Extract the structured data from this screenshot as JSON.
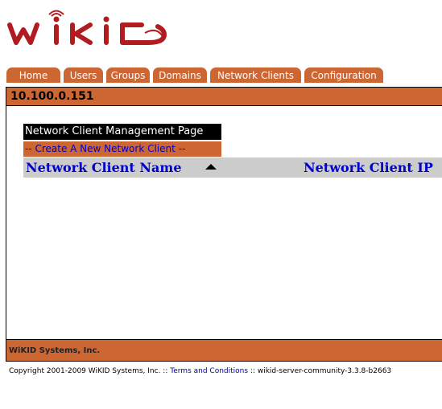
{
  "brand": {
    "logo_text": "WiKID",
    "accent_color": "#cc6633",
    "logo_color": "#b01c20"
  },
  "nav": {
    "tabs": [
      {
        "label": "Home"
      },
      {
        "label": "Users"
      },
      {
        "label": "Groups"
      },
      {
        "label": "Domains"
      },
      {
        "label": "Network Clients"
      },
      {
        "label": "Configuration"
      }
    ]
  },
  "server": {
    "ip": "10.100.0.151"
  },
  "main": {
    "page_title": "Network Client Management Page",
    "create_link": "-- Create A New Network Client --",
    "columns": [
      {
        "label": "Network Client Name",
        "sort_icon": "sort-ascending-icon"
      },
      {
        "label": "Network Client IP"
      }
    ],
    "rows": []
  },
  "footer": {
    "company": "WiKID Systems, Inc.",
    "copyright": "Copyright 2001-2009 WiKID Systems, Inc. ::",
    "terms_link": "Terms and Conditions",
    "version": ":: wikid-server-community-3.3.8-b2663"
  }
}
